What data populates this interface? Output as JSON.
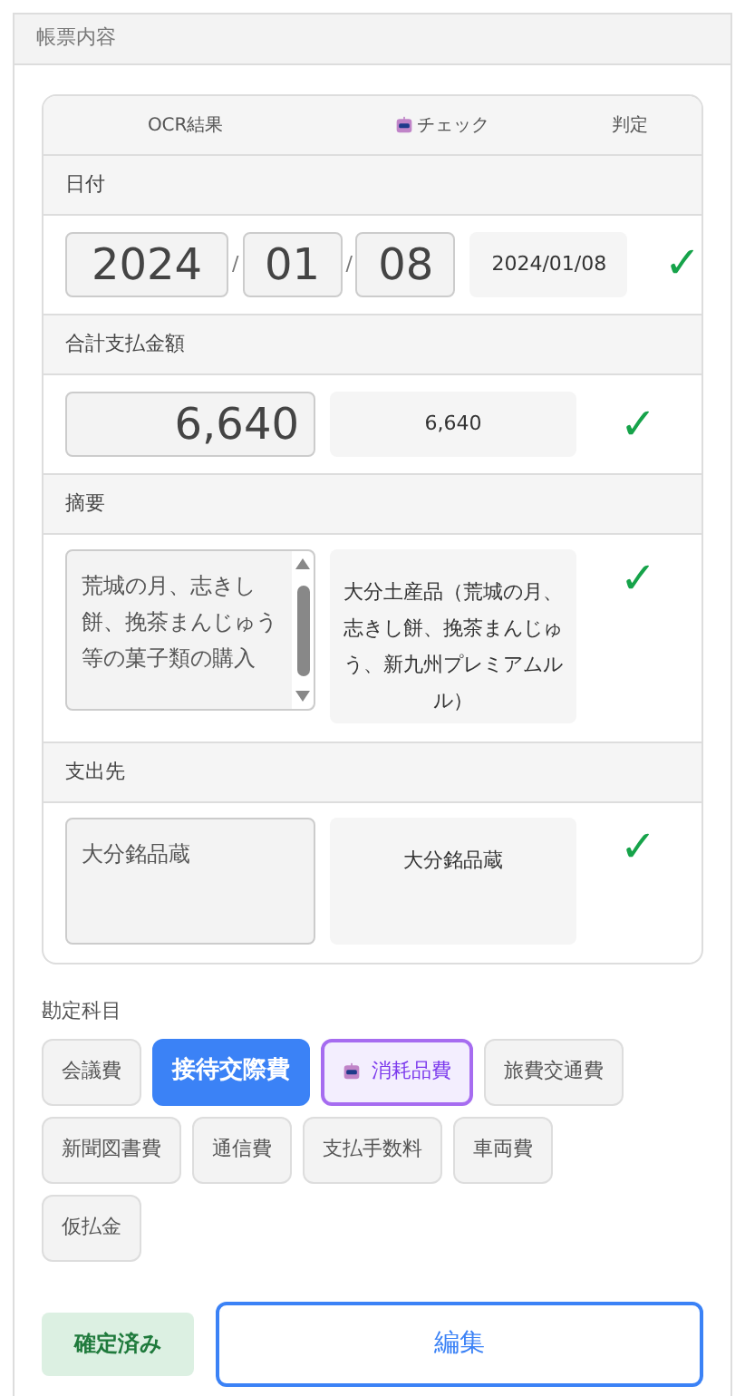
{
  "panel_title": "帳票内容",
  "table": {
    "columns": [
      "OCR結果",
      "チェック",
      "判定"
    ],
    "rows": [
      {
        "kind": "date",
        "label": "日付",
        "ocr_parts": [
          "2024",
          "01",
          "08"
        ],
        "separator": "/",
        "check": "2024/01/08",
        "judgement": "✓"
      },
      {
        "kind": "amount",
        "label": "合計支払金額",
        "ocr": "6,640",
        "check": "6,640",
        "judgement": "✓"
      },
      {
        "kind": "text",
        "label": "摘要",
        "ocr": "荒城の月、志きし餅、挽茶まんじゅう等の菓子類の購入",
        "scrollable": true,
        "check": "大分土産品（荒城の月、志きし餅、挽茶まんじゅう、新九州プレミアムルル）",
        "judgement": "✓"
      },
      {
        "kind": "text",
        "label": "支出先",
        "ocr": "大分銘品蔵",
        "scrollable": false,
        "check": "大分銘品蔵",
        "judgement": "✓"
      }
    ]
  },
  "accounts": {
    "label": "勘定科目",
    "items": [
      {
        "label": "会議費",
        "selected": false,
        "suggested": false
      },
      {
        "label": "接待交際費",
        "selected": true,
        "suggested": false
      },
      {
        "label": "消耗品費",
        "selected": false,
        "suggested": true
      },
      {
        "label": "旅費交通費",
        "selected": false,
        "suggested": false
      },
      {
        "label": "新聞図書費",
        "selected": false,
        "suggested": false
      },
      {
        "label": "通信費",
        "selected": false,
        "suggested": false
      },
      {
        "label": "支払手数料",
        "selected": false,
        "suggested": false
      },
      {
        "label": "車両費",
        "selected": false,
        "suggested": false
      },
      {
        "label": "仮払金",
        "selected": false,
        "suggested": false
      }
    ]
  },
  "status": "確定済み",
  "edit_button": "編集"
}
